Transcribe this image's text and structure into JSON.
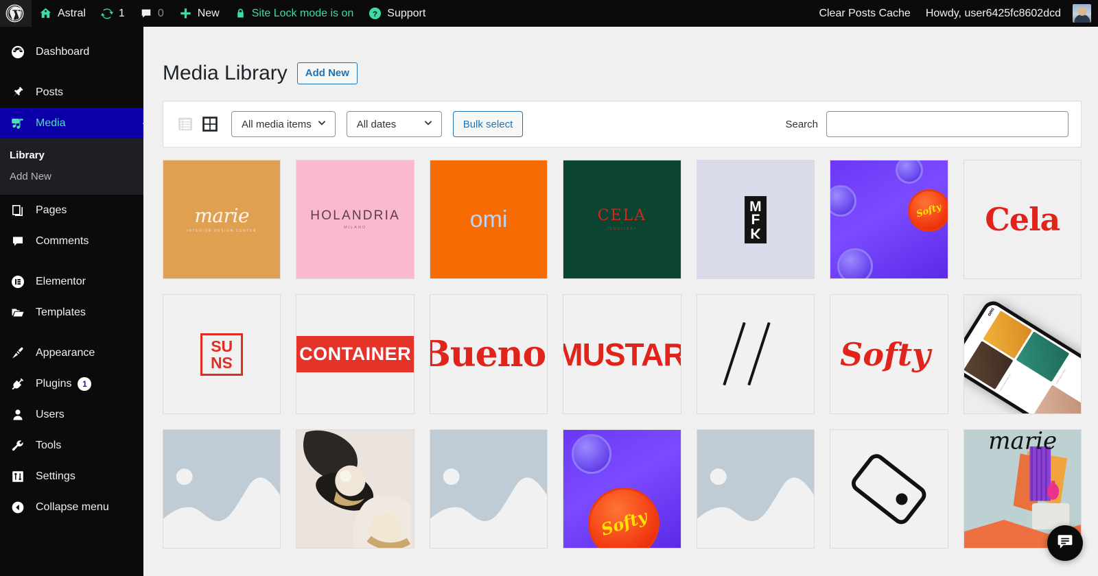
{
  "adminbar": {
    "wp_logo": "wordpress-logo",
    "site_name": "Astral",
    "updates_count": "1",
    "comments_count": "0",
    "new_label": "New",
    "site_lock_label": "Site Lock mode is on",
    "support_label": "Support",
    "clear_cache_label": "Clear Posts Cache",
    "howdy_label": "Howdy, user6425fc8602dcd",
    "accent_green": "#3fdba4"
  },
  "sidebar": {
    "items": [
      {
        "label": "Dashboard",
        "icon": "dashboard-icon"
      },
      {
        "label": "Posts",
        "icon": "pin-icon"
      },
      {
        "label": "Media",
        "icon": "media-icon",
        "current": true
      },
      {
        "label": "Pages",
        "icon": "pages-icon"
      },
      {
        "label": "Comments",
        "icon": "comments-icon"
      },
      {
        "label": "Elementor",
        "icon": "elementor-icon"
      },
      {
        "label": "Templates",
        "icon": "folder-icon"
      },
      {
        "label": "Appearance",
        "icon": "paintbrush-icon"
      },
      {
        "label": "Plugins",
        "icon": "plug-icon",
        "badge": "1"
      },
      {
        "label": "Users",
        "icon": "user-icon"
      },
      {
        "label": "Tools",
        "icon": "wrench-icon"
      },
      {
        "label": "Settings",
        "icon": "sliders-icon"
      },
      {
        "label": "Collapse menu",
        "icon": "collapse-arrow-icon"
      }
    ],
    "submenu": [
      {
        "label": "Library",
        "active": true
      },
      {
        "label": "Add New",
        "active": false
      }
    ],
    "current_bg": "#0b00a8",
    "current_fg": "#44e3b1"
  },
  "page": {
    "title": "Media Library",
    "add_new_label": "Add New"
  },
  "toolbar": {
    "list_view_icon": "list-view-icon",
    "grid_view_icon": "grid-view-icon",
    "media_filter_value": "All media items",
    "date_filter_value": "All dates",
    "bulk_select_label": "Bulk select",
    "search_label": "Search",
    "search_value": "",
    "search_placeholder": ""
  },
  "grid": {
    "items": [
      {
        "kind": "brand-marie",
        "name": "media-item-marie-orange",
        "word": "marie",
        "sub": "INTERIOR DESIGN CENTER"
      },
      {
        "kind": "brand-holandria",
        "name": "media-item-holandria",
        "word": "HOLANDRIA",
        "sub": "MILANO"
      },
      {
        "kind": "brand-omi",
        "name": "media-item-omi",
        "word": "omi",
        "sub": ""
      },
      {
        "kind": "brand-cela-dark",
        "name": "media-item-cela-green",
        "word": "CELA",
        "sub": "JEWELLERY"
      },
      {
        "kind": "brand-mfk",
        "name": "media-item-mfk",
        "word": "MFK",
        "sub": ""
      },
      {
        "kind": "photo-caps-a",
        "name": "media-item-bottle-caps-purple",
        "word": "Softy",
        "sub": ""
      },
      {
        "kind": "brand-cela-light",
        "name": "media-item-cela-red",
        "word": "Cela",
        "sub": ""
      },
      {
        "kind": "brand-suns",
        "name": "media-item-suns",
        "word": "SUNS",
        "sub": ""
      },
      {
        "kind": "band-container",
        "name": "media-item-container",
        "word": "CONTAINER",
        "sub": ""
      },
      {
        "kind": "word-bueno",
        "name": "media-item-bueno",
        "word": "Bueno",
        "sub": ""
      },
      {
        "kind": "word-mustard",
        "name": "media-item-mustard",
        "word": "MUSTARD",
        "sub": ""
      },
      {
        "kind": "slashes",
        "name": "media-item-slashes",
        "word": "//",
        "sub": ""
      },
      {
        "kind": "word-softy",
        "name": "media-item-softy",
        "word": "Softy",
        "sub": ""
      },
      {
        "kind": "phone-mockup",
        "name": "media-item-phone-mockup",
        "word": "omi",
        "sub": ""
      },
      {
        "kind": "placeholder",
        "name": "media-item-placeholder-1",
        "word": "",
        "sub": ""
      },
      {
        "kind": "photo-pearls",
        "name": "media-item-pearls",
        "word": "",
        "sub": ""
      },
      {
        "kind": "placeholder",
        "name": "media-item-placeholder-2",
        "word": "",
        "sub": ""
      },
      {
        "kind": "photo-caps-b",
        "name": "media-item-bottle-cap-softy",
        "word": "Softy",
        "sub": ""
      },
      {
        "kind": "placeholder",
        "name": "media-item-placeholder-3",
        "word": "",
        "sub": ""
      },
      {
        "kind": "tag-outline",
        "name": "media-item-tag-outline",
        "word": "",
        "sub": ""
      },
      {
        "kind": "poster-marie",
        "name": "media-item-marie-poster",
        "word": "marie",
        "sub": ""
      }
    ]
  },
  "chat": {
    "icon": "chat-bubble-icon"
  }
}
